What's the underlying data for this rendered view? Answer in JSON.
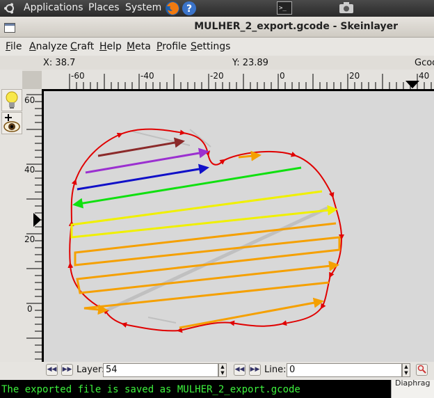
{
  "top_panel": {
    "applications": "Applications",
    "places": "Places",
    "system": "System"
  },
  "window": {
    "title": "MULHER_2_export.gcode - Skeinlayer"
  },
  "menu": [
    "File",
    "Analyze",
    "Craft",
    "Help",
    "Meta",
    "Profile",
    "Settings"
  ],
  "readout": {
    "x": "X: 38.7",
    "y": "Y: 23.89",
    "right": "Gcod"
  },
  "ruler_x": [
    "-60",
    "-40",
    "-20",
    "0",
    "20",
    "40"
  ],
  "ruler_y": [
    "60",
    "40",
    "20",
    "0"
  ],
  "layer": {
    "label": "Layer:",
    "value": "54"
  },
  "line": {
    "label": "Line:",
    "value": "0"
  },
  "terminal": {
    "text": "The exported file is saved as MULHER_2_export.gcode"
  },
  "side_panel": {
    "text": "Diaphrag"
  },
  "colors": {
    "perimeter": "#e00000",
    "travel": "#c0c0c0",
    "brown": "#8b2a2a",
    "purple": "#9b30d0",
    "blue": "#1010c8",
    "green": "#10e010",
    "yellow": "#f0f000",
    "orange": "#f5a000"
  }
}
